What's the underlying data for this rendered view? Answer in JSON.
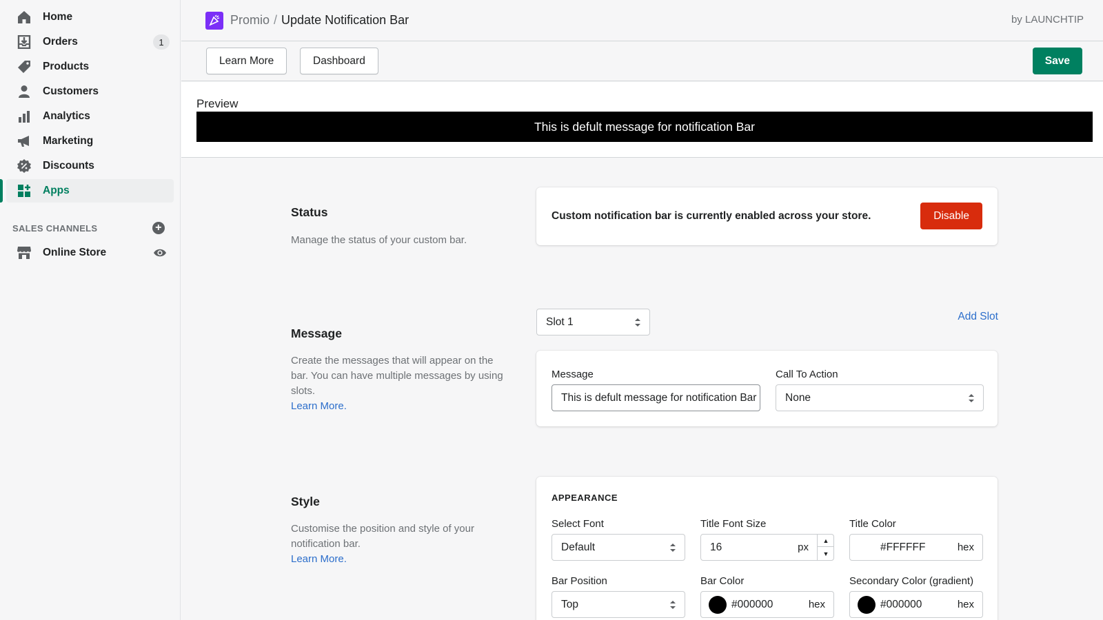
{
  "sidebar": {
    "items": [
      {
        "label": "Home",
        "icon": "home-icon"
      },
      {
        "label": "Orders",
        "icon": "orders-icon",
        "badge": "1"
      },
      {
        "label": "Products",
        "icon": "tag-icon"
      },
      {
        "label": "Customers",
        "icon": "person-icon"
      },
      {
        "label": "Analytics",
        "icon": "bar-chart-icon"
      },
      {
        "label": "Marketing",
        "icon": "megaphone-icon"
      },
      {
        "label": "Discounts",
        "icon": "discount-icon"
      },
      {
        "label": "Apps",
        "icon": "apps-icon",
        "active": true
      }
    ],
    "sales_channels_label": "SALES CHANNELS",
    "online_store_label": "Online Store"
  },
  "header": {
    "app_name": "Promio",
    "separator": "/",
    "page_title": "Update Notification Bar",
    "by_label": "by LAUNCHTIP"
  },
  "toolbar": {
    "learn_more_label": "Learn More",
    "dashboard_label": "Dashboard",
    "save_label": "Save"
  },
  "preview": {
    "label": "Preview",
    "message": "This is defult message for notification Bar",
    "bar_color": "#000000",
    "text_color": "#FFFFFF"
  },
  "status": {
    "title": "Status",
    "description": "Manage the status of your custom bar.",
    "status_text": "Custom notification bar is currently enabled across your store.",
    "disable_label": "Disable"
  },
  "message_section": {
    "title": "Message",
    "description": "Create the messages that will appear on the bar. You can have multiple messages by using slots.",
    "learn_more": "Learn More.",
    "slot_value": "Slot 1",
    "add_slot_label": "Add Slot",
    "message_label": "Message",
    "message_value": "This is defult message for notification Bar",
    "cta_label": "Call To Action",
    "cta_value": "None"
  },
  "style_section": {
    "title": "Style",
    "description": "Customise the position and style of your notification bar.",
    "learn_more": "Learn More.",
    "appearance_heading": "APPEARANCE",
    "select_font_label": "Select Font",
    "select_font_value": "Default",
    "title_font_size_label": "Title Font Size",
    "title_font_size_value": "16",
    "title_font_size_unit": "px",
    "title_color_label": "Title Color",
    "title_color_value": "#FFFFFF",
    "hex_suffix": "hex",
    "bar_position_label": "Bar Position",
    "bar_position_value": "Top",
    "bar_color_label": "Bar Color",
    "bar_color_value": "#000000",
    "secondary_color_label": "Secondary Color (gradient)",
    "secondary_color_value": "#000000"
  },
  "colors": {
    "accent_green": "#008060",
    "danger_red": "#D82C0D",
    "link_blue": "#2C6ECB",
    "logo_purple": "#7B2FF7"
  }
}
